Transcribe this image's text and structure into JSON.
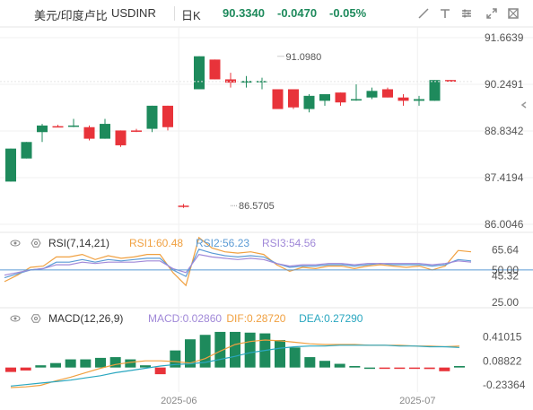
{
  "header": {
    "pair_name": "美元/印度卢比",
    "symbol": "USDINR",
    "period": "日K",
    "price": "90.3340",
    "change": "-0.0470",
    "change_pct": "-0.05%",
    "icons": [
      "ruler-icon",
      "text-icon",
      "brush-icon",
      "expand-icon",
      "fullscreen-icon"
    ]
  },
  "colors": {
    "up": "#1e8a5c",
    "down": "#e8333a",
    "rsi1": "#f0a040",
    "rsi2": "#5b9bd5",
    "rsi3": "#a088d8",
    "macd": "#a088d8",
    "dif": "#f0a040",
    "dea": "#2aa7c0",
    "price_label": "#1e8a5c",
    "high_label": "#e8333a"
  },
  "chart_data": [
    {
      "type": "candlestick",
      "name": "main",
      "ylim": [
        86.0046,
        91.6639
      ],
      "y_ticks": [
        "91.6639",
        "90.2491",
        "88.8342",
        "87.4194",
        "86.0046"
      ],
      "x_ticks": [
        {
          "label": "2025-06",
          "at": 10.7
        },
        {
          "label": "2025-07",
          "at": 25.9
        }
      ],
      "annotations": [
        {
          "text": "91.0980",
          "x": 17,
          "y": 91.098
        },
        {
          "text": "86.5705",
          "x": 14,
          "y": 86.5705
        }
      ],
      "last_price": 90.334,
      "candles": [
        {
          "o": 87.3,
          "h": 88.3,
          "l": 87.3,
          "c": 88.3
        },
        {
          "o": 88.0,
          "h": 88.5,
          "l": 88.0,
          "c": 88.5
        },
        {
          "o": 88.8,
          "h": 89.05,
          "l": 88.5,
          "c": 89.0
        },
        {
          "o": 88.98,
          "h": 89.02,
          "l": 88.95,
          "c": 88.95
        },
        {
          "o": 89.0,
          "h": 89.2,
          "l": 88.95,
          "c": 89.0
        },
        {
          "o": 88.95,
          "h": 89.0,
          "l": 88.55,
          "c": 88.6
        },
        {
          "o": 88.6,
          "h": 89.2,
          "l": 88.6,
          "c": 89.05
        },
        {
          "o": 88.85,
          "h": 88.85,
          "l": 88.35,
          "c": 88.4
        },
        {
          "o": 88.85,
          "h": 88.9,
          "l": 88.8,
          "c": 88.82
        },
        {
          "o": 88.9,
          "h": 89.6,
          "l": 88.8,
          "c": 89.6
        },
        {
          "o": 89.6,
          "h": 89.6,
          "l": 88.85,
          "c": 88.95
        },
        {
          "o": 86.57,
          "h": 86.62,
          "l": 86.5,
          "c": 86.55
        },
        {
          "o": 90.1,
          "h": 91.1,
          "l": 90.1,
          "c": 91.1
        },
        {
          "o": 91.0,
          "h": 91.0,
          "l": 90.4,
          "c": 90.4
        },
        {
          "o": 90.4,
          "h": 90.6,
          "l": 90.15,
          "c": 90.3
        },
        {
          "o": 90.3,
          "h": 90.5,
          "l": 90.15,
          "c": 90.35
        },
        {
          "o": 90.35,
          "h": 90.45,
          "l": 90.1,
          "c": 90.35
        },
        {
          "o": 90.1,
          "h": 90.1,
          "l": 89.5,
          "c": 89.5
        },
        {
          "o": 90.1,
          "h": 90.1,
          "l": 89.5,
          "c": 89.55
        },
        {
          "o": 89.5,
          "h": 89.95,
          "l": 89.4,
          "c": 89.9
        },
        {
          "o": 89.75,
          "h": 89.95,
          "l": 89.6,
          "c": 89.95
        },
        {
          "o": 90.0,
          "h": 90.0,
          "l": 89.6,
          "c": 89.7
        },
        {
          "o": 89.8,
          "h": 90.25,
          "l": 89.75,
          "c": 89.8
        },
        {
          "o": 89.85,
          "h": 90.15,
          "l": 89.8,
          "c": 90.05
        },
        {
          "o": 90.1,
          "h": 90.15,
          "l": 89.85,
          "c": 89.85
        },
        {
          "o": 89.85,
          "h": 89.95,
          "l": 89.6,
          "c": 89.75
        },
        {
          "o": 89.75,
          "h": 89.9,
          "l": 89.6,
          "c": 89.8
        },
        {
          "o": 89.75,
          "h": 90.38,
          "l": 89.75,
          "c": 90.38
        },
        {
          "o": 90.38,
          "h": 90.38,
          "l": 90.33,
          "c": 90.33
        }
      ]
    },
    {
      "type": "line",
      "name": "RSI",
      "label": "RSI(7,14,21)",
      "ylim": [
        25,
        70
      ],
      "y_ticks": [
        "65.64",
        "50.00",
        "45.32",
        "25.00"
      ],
      "legend": [
        {
          "text": "RSI1:60.48",
          "color": "#f0a040"
        },
        {
          "text": "RSI2:56.23",
          "color": "#5b9bd5"
        },
        {
          "text": "RSI3:54.56",
          "color": "#a088d8"
        }
      ],
      "series": [
        {
          "values": [
            41,
            46,
            52,
            53,
            60,
            60,
            62,
            58,
            61,
            59,
            60,
            62,
            62,
            48,
            38,
            75,
            67,
            64,
            63,
            64,
            62,
            54,
            49,
            52,
            51,
            53,
            53,
            51,
            53,
            54,
            53,
            52,
            53,
            50,
            53,
            65,
            64
          ]
        },
        {
          "values": [
            44,
            47,
            50,
            51,
            56,
            56,
            58,
            56,
            58,
            57,
            58,
            59,
            59,
            50,
            45,
            66,
            63,
            61,
            60,
            61,
            60,
            55,
            52,
            53,
            53,
            54,
            54,
            53,
            54,
            55,
            54,
            54,
            54,
            53,
            54,
            58,
            57
          ]
        },
        {
          "values": [
            46,
            48,
            50,
            51,
            54,
            54,
            56,
            55,
            56,
            56,
            56,
            57,
            57,
            51,
            48,
            62,
            60,
            59,
            58,
            59,
            58,
            55,
            53,
            54,
            54,
            55,
            55,
            54,
            55,
            55,
            55,
            55,
            55,
            54,
            55,
            57,
            56
          ]
        }
      ]
    },
    {
      "type": "bar",
      "name": "MACD",
      "label": "MACD(12,26,9)",
      "ylim": [
        -0.27,
        0.6
      ],
      "y_ticks": [
        "0.41015",
        "0.08822",
        "-0.23364"
      ],
      "legend": [
        {
          "text": "MACD:0.02860",
          "color": "#a088d8"
        },
        {
          "text": "DIF:0.28720",
          "color": "#f0a040"
        },
        {
          "text": "DEA:0.27290",
          "color": "#2aa7c0"
        }
      ],
      "bars": [
        -0.06,
        -0.04,
        0.03,
        0.06,
        0.11,
        0.11,
        0.13,
        0.14,
        0.11,
        0.03,
        -0.09,
        0.23,
        0.38,
        0.44,
        0.48,
        0.48,
        0.47,
        0.46,
        0.37,
        0.27,
        0.14,
        0.09,
        0.05,
        0.02,
        0.0,
        -0.01,
        -0.01,
        -0.01,
        -0.02,
        -0.05,
        0.02
      ],
      "dif_line": [
        -0.27,
        -0.26,
        -0.24,
        -0.18,
        -0.13,
        -0.07,
        -0.01,
        0.04,
        0.07,
        0.09,
        0.09,
        0.08,
        0.06,
        0.12,
        0.22,
        0.31,
        0.35,
        0.37,
        0.36,
        0.34,
        0.32,
        0.31,
        0.31,
        0.31,
        0.3,
        0.3,
        0.3,
        0.29,
        0.29,
        0.28,
        0.29
      ],
      "dea_line": [
        -0.25,
        -0.23,
        -0.21,
        -0.19,
        -0.17,
        -0.14,
        -0.11,
        -0.07,
        -0.04,
        -0.01,
        0.02,
        0.04,
        0.05,
        0.07,
        0.11,
        0.15,
        0.2,
        0.23,
        0.26,
        0.28,
        0.29,
        0.29,
        0.3,
        0.3,
        0.3,
        0.3,
        0.29,
        0.29,
        0.28,
        0.28,
        0.27
      ]
    }
  ]
}
